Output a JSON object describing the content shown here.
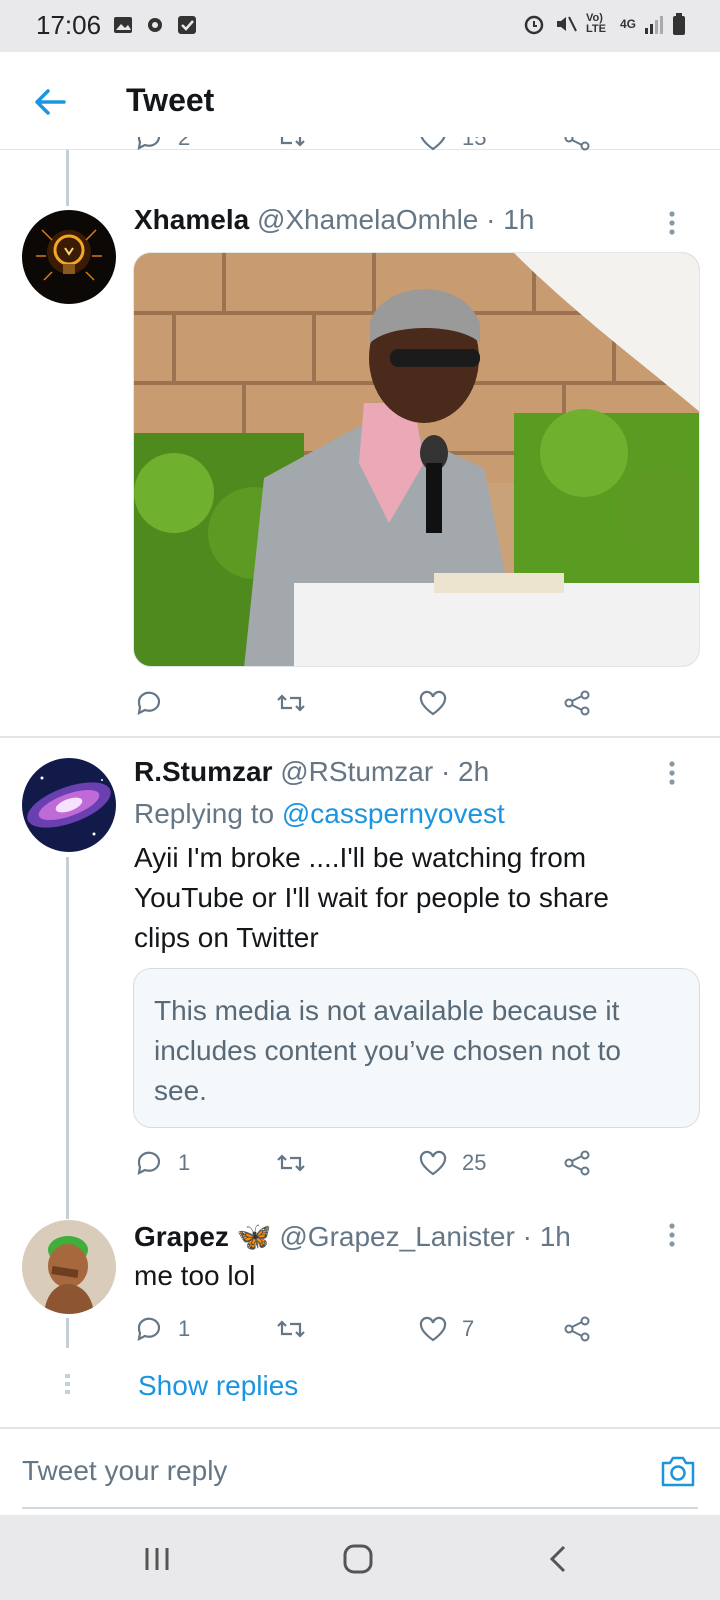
{
  "status_bar": {
    "time": "17:06",
    "net_label": "Vo) LTE",
    "net_type": "4G"
  },
  "header": {
    "title": "Tweet"
  },
  "top_actions": {
    "reply_count": "2",
    "like_count": "15"
  },
  "tweets": [
    {
      "name": "Xhamela",
      "handle": "@XhamelaOmhle",
      "time": "· 1h",
      "has_photo": true
    },
    {
      "name": "R.Stumzar",
      "handle": "@RStumzar",
      "time": "· 2h",
      "replying_prefix": "Replying to",
      "replying_handle": "@casspernyovest",
      "text_lines": [
        "Ayii I'm broke ....I'll be watching from",
        "YouTube or I'll wait for people to share",
        "clips on Twitter"
      ],
      "hidden_media_text": "This media is not available because it includes content you’ve chosen not to see.",
      "reply_count": "1",
      "like_count": "25"
    },
    {
      "name": "Grapez",
      "emoji": "🦋",
      "handle": "@Grapez_Lanister",
      "time": "· 1h",
      "text": "me too lol",
      "reply_count": "1",
      "like_count": "7"
    }
  ],
  "show_replies": "Show replies",
  "composer": {
    "placeholder": "Tweet your reply"
  },
  "colors": {
    "accent": "#1b95e0",
    "secondary_text": "#657786",
    "divider": "#e1e6ea"
  }
}
